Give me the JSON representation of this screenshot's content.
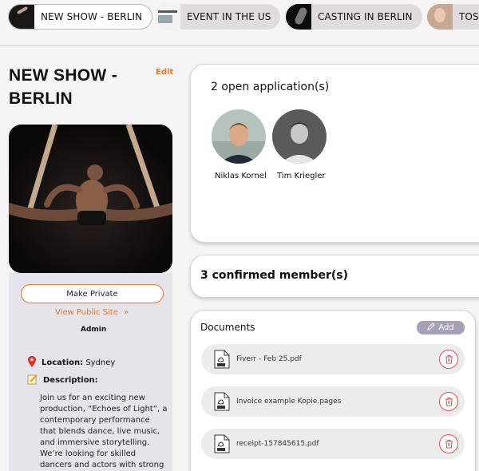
{
  "tabs": [
    {
      "label": "NEW SHOW - BERLIN",
      "thumb": "aerial-dancer-thumbnail",
      "active": true
    },
    {
      "label": "EVENT IN THE US",
      "thumb": "webpage-thumbnail",
      "active": false
    },
    {
      "label": "CASTING IN BERLIN",
      "thumb": "performer-thumbnail",
      "active": false
    },
    {
      "label": "TOSK",
      "thumb": "portrait-thumbnail",
      "active": false
    }
  ],
  "show": {
    "title": "NEW SHOW - BERLIN",
    "edit_label": "Edit",
    "make_private_label": "Make Private",
    "view_public_label": "View Public Site",
    "role": "Admin",
    "location_label": "Location:",
    "location_value": "Sydney",
    "description_label": "Description:",
    "description": "Join us for an exciting new production, “Echoes of Light”, a contemporary performance that blends dance, live music, and immersive storytelling. We’re looking for skilled dancers and actors with strong stage"
  },
  "applications": {
    "title": "2 open application(s)",
    "applicants": [
      {
        "name": "Niklas Kornel"
      },
      {
        "name": "Tim Kriegler"
      }
    ]
  },
  "members": {
    "title": "3 confirmed member(s)"
  },
  "documents": {
    "title": "Documents",
    "add_label": "Add",
    "files": [
      {
        "name": "Fiverr - Feb 25.pdf"
      },
      {
        "name": "Invoice example Kopie.pages"
      },
      {
        "name": "receipt-157845615.pdf"
      }
    ]
  },
  "colors": {
    "accent": "#e07a2b",
    "add_button": "#a8a0b6",
    "delete": "#d9534f",
    "panel": "#e4e4ea"
  }
}
